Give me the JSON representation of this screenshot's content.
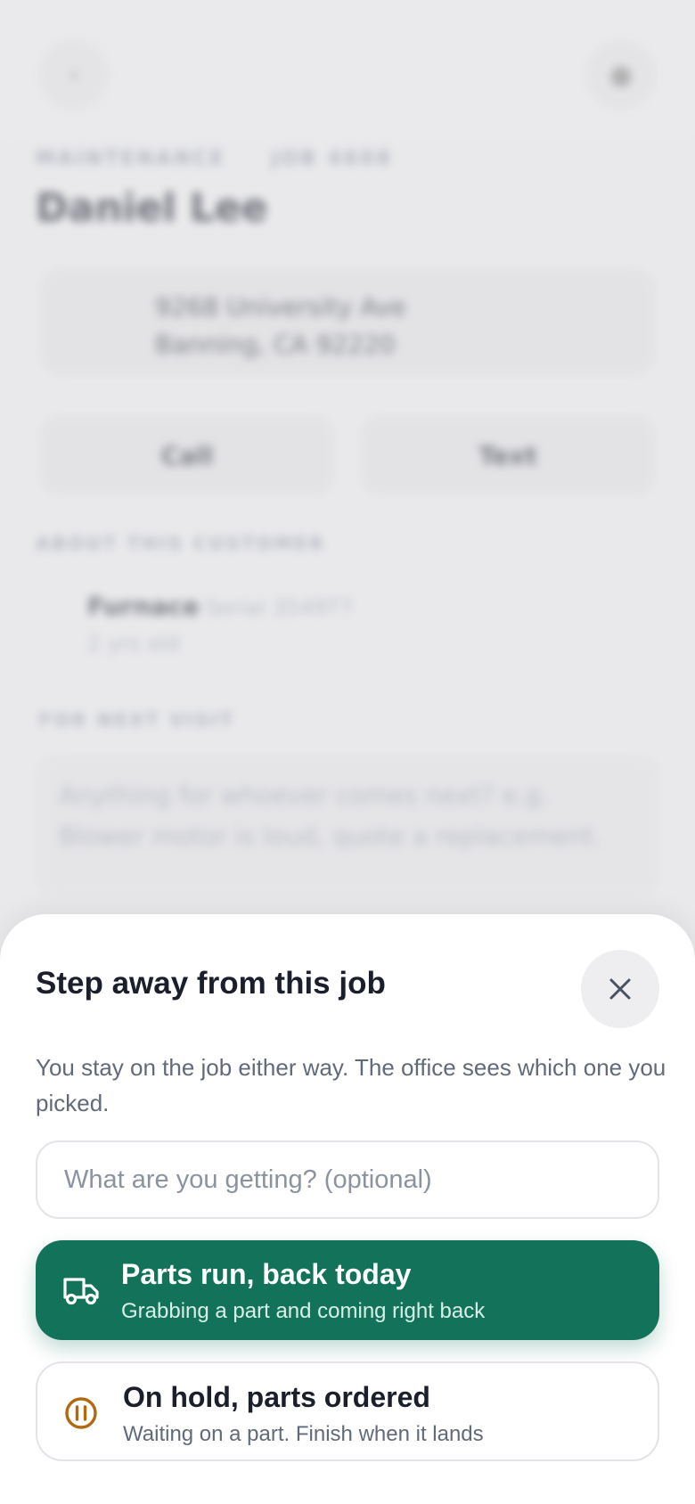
{
  "background": {
    "back_icon": "chevron-left-icon",
    "profile_icon": "user-icon",
    "eyebrow": [
      "MAINTENANCE",
      "JOB 4608"
    ],
    "customer_name": "Daniel Lee",
    "address_line1": "9268 University Ave",
    "address_line2": "Banning, CA 92220",
    "call_label": "Call",
    "text_label": "Text",
    "section_label": "ABOUT THIS CUSTOMER",
    "equipment_title": "Furnace",
    "equipment_serial": "Serial 3549T7",
    "equipment_sub": "2 yrs old",
    "notes_label": "FOR NEXT VISIT",
    "notes_placeholder": "Anything for whoever comes next? e.g. Blower motor is loud, quote a replacement."
  },
  "sheet": {
    "title": "Step away from this job",
    "close_icon": "close-icon",
    "description": "You stay on the job either way. The office sees which one you picked.",
    "input": {
      "placeholder": "What are you getting? (optional)",
      "value": ""
    },
    "options": [
      {
        "icon": "truck-icon",
        "title": "Parts run, back today",
        "subtitle": "Grabbing a part and coming right back",
        "selected": true
      },
      {
        "icon": "pause-icon",
        "title": "On hold, parts ordered",
        "subtitle": "Waiting on a part. Finish when it lands",
        "selected": false
      }
    ]
  },
  "colors": {
    "accent": "#13735a",
    "hold": "#b26a10",
    "text_primary": "#1a1f2b",
    "text_secondary": "#616a7a"
  }
}
